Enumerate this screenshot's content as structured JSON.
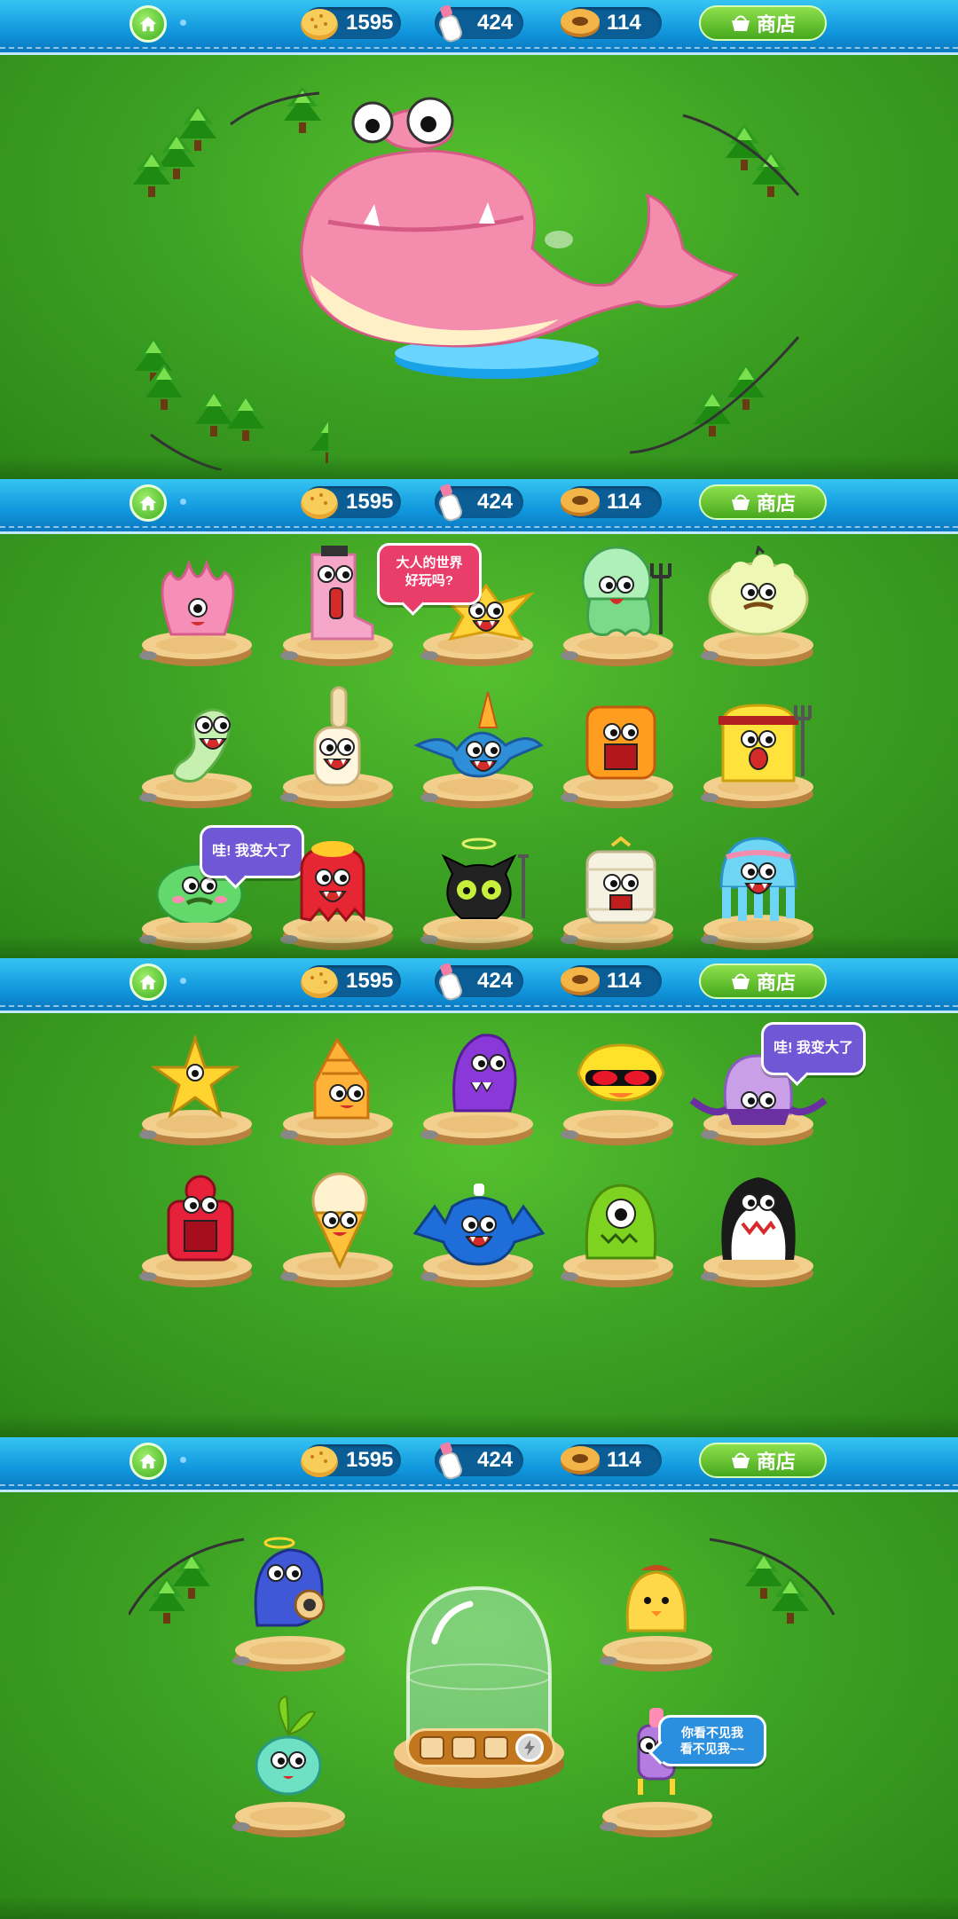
{
  "hud": {
    "cookies": "1595",
    "milk": "424",
    "donuts": "114",
    "shop_label": "商店"
  },
  "bubbles": {
    "adult_world": "大人的世界\n好玩吗?",
    "grew_up": "哇! 我变大了",
    "grew_up_2": "哇! 我变大了",
    "invisible": "你看不见我\n看不见我~~"
  },
  "colors": {
    "bar": "#1197dd",
    "grass": "#3ea324",
    "shop": "#46a81d",
    "bubble_pink": "#ea3e6a",
    "bubble_purple": "#6f57d6",
    "bubble_blue": "#2b8fe0"
  }
}
